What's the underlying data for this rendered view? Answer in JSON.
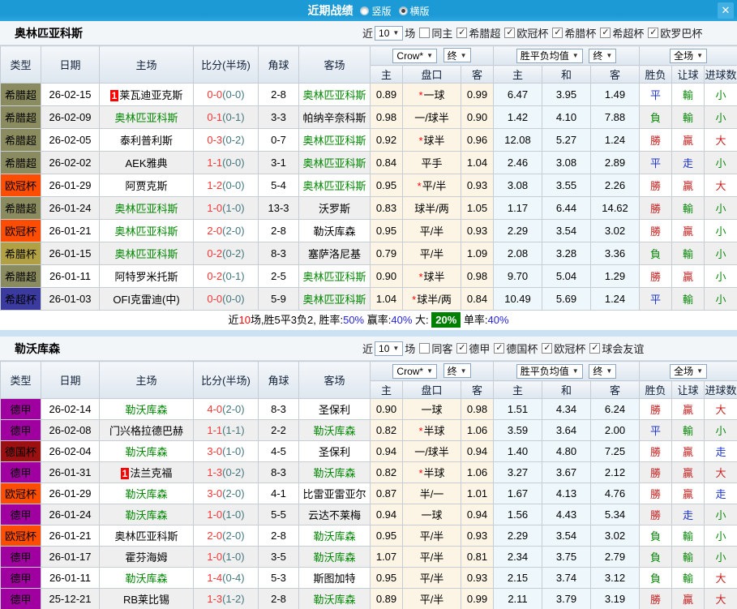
{
  "titlebar": {
    "title": "近期战绩",
    "vertical": "竖版",
    "horizontal": "横版",
    "close": "✕"
  },
  "filter_labels": {
    "near": "近",
    "games": "场"
  },
  "controls": {
    "count": "10",
    "company": "Crow*",
    "final": "终",
    "avg": "胜平负均值",
    "full": "全场"
  },
  "columns": {
    "type": "类型",
    "date": "日期",
    "home": "主场",
    "score": "比分(半场)",
    "corner": "角球",
    "away": "客场",
    "h": "主",
    "handicap": "盘口",
    "a": "客",
    "avg_h": "主",
    "avg_d": "和",
    "avg_a": "客",
    "wdl": "胜负",
    "ah": "让球",
    "goals": "进球数"
  },
  "misc": {
    "star": "*",
    "badge": "1"
  },
  "league_colors": {
    "希腊超": "#8b8b60",
    "欧冠杯": "#fc4d02",
    "希腊杯": "#b2a144",
    "希超杯": "#3a3a9f",
    "德甲": "#a100a1",
    "德国杯": "#9b1111"
  },
  "result_colors": {
    "勝": "#c82121",
    "贏": "#c82121",
    "大": "#c82121",
    "平": "#1d35cc",
    "走": "#1d35cc",
    "負": "#0b8a0b",
    "輸": "#0b8a0b",
    "小": "#0b8a0b"
  },
  "colors": {
    "titlebar": "#1c9ad6",
    "separator": "#cbe2f4",
    "team_highlight": "#008800",
    "score_fulltime": "#ff3333",
    "score_halftime": "#44787f",
    "corner": "#26439c",
    "summary_badge_bg": "#008000",
    "summary_value": "#2323dd"
  },
  "sections": [
    {
      "team": "奥林匹亚科斯",
      "filters": {
        "same": "同主",
        "leagues": [
          "希腊超",
          "欧冠杯",
          "希腊杯",
          "希超杯",
          "欧罗巴杯"
        ]
      },
      "rows": [
        {
          "league": "希腊超",
          "date": "26-02-15",
          "home": "莱瓦迪亚克斯",
          "home_badge": true,
          "home_self": false,
          "score": "0-0",
          "half": "(0-0)",
          "corner": "2-8",
          "away": "奥林匹亚科斯",
          "away_self": true,
          "odds_h": "0.89",
          "star": true,
          "handicap": "一球",
          "odds_a": "0.99",
          "avg_h": "6.47",
          "avg_d": "3.95",
          "avg_a": "1.49",
          "wdl": "平",
          "ah": "輸",
          "goal": "小"
        },
        {
          "league": "希腊超",
          "date": "26-02-09",
          "home": "奥林匹亚科斯",
          "home_self": true,
          "score": "0-1",
          "half": "(0-1)",
          "corner": "3-3",
          "away": "帕纳辛奈科斯",
          "away_self": false,
          "odds_h": "0.98",
          "star": false,
          "handicap": "一/球半",
          "odds_a": "0.90",
          "avg_h": "1.42",
          "avg_d": "4.10",
          "avg_a": "7.88",
          "wdl": "負",
          "ah": "輸",
          "goal": "小"
        },
        {
          "league": "希腊超",
          "date": "26-02-05",
          "home": "泰利普利斯",
          "home_self": false,
          "score": "0-3",
          "half": "(0-2)",
          "corner": "0-7",
          "away": "奥林匹亚科斯",
          "away_self": true,
          "odds_h": "0.92",
          "star": true,
          "handicap": "球半",
          "odds_a": "0.96",
          "avg_h": "12.08",
          "avg_d": "5.27",
          "avg_a": "1.24",
          "wdl": "勝",
          "ah": "贏",
          "goal": "大"
        },
        {
          "league": "希腊超",
          "date": "26-02-02",
          "home": "AEK雅典",
          "home_self": false,
          "score": "1-1",
          "half": "(0-0)",
          "corner": "3-1",
          "away": "奥林匹亚科斯",
          "away_self": true,
          "odds_h": "0.84",
          "star": false,
          "handicap": "平手",
          "odds_a": "1.04",
          "avg_h": "2.46",
          "avg_d": "3.08",
          "avg_a": "2.89",
          "wdl": "平",
          "ah": "走",
          "goal": "小"
        },
        {
          "league": "欧冠杯",
          "date": "26-01-29",
          "home": "阿贾克斯",
          "home_self": false,
          "score": "1-2",
          "half": "(0-0)",
          "corner": "5-4",
          "away": "奥林匹亚科斯",
          "away_self": true,
          "odds_h": "0.95",
          "star": true,
          "handicap": "平/半",
          "odds_a": "0.93",
          "avg_h": "3.08",
          "avg_d": "3.55",
          "avg_a": "2.26",
          "wdl": "勝",
          "ah": "贏",
          "goal": "大"
        },
        {
          "league": "希腊超",
          "date": "26-01-24",
          "home": "奥林匹亚科斯",
          "home_self": true,
          "score": "1-0",
          "half": "(1-0)",
          "corner": "13-3",
          "away": "沃罗斯",
          "away_self": false,
          "odds_h": "0.83",
          "star": false,
          "handicap": "球半/两",
          "odds_a": "1.05",
          "avg_h": "1.17",
          "avg_d": "6.44",
          "avg_a": "14.62",
          "wdl": "勝",
          "ah": "輸",
          "goal": "小"
        },
        {
          "league": "欧冠杯",
          "date": "26-01-21",
          "home": "奥林匹亚科斯",
          "home_self": true,
          "score": "2-0",
          "half": "(2-0)",
          "corner": "2-8",
          "away": "勒沃库森",
          "away_self": false,
          "odds_h": "0.95",
          "star": false,
          "handicap": "平/半",
          "odds_a": "0.93",
          "avg_h": "2.29",
          "avg_d": "3.54",
          "avg_a": "3.02",
          "wdl": "勝",
          "ah": "贏",
          "goal": "小"
        },
        {
          "league": "希腊杯",
          "date": "26-01-15",
          "home": "奥林匹亚科斯",
          "home_self": true,
          "score": "0-2",
          "half": "(0-2)",
          "corner": "8-3",
          "away": "塞萨洛尼基",
          "away_self": false,
          "odds_h": "0.79",
          "star": false,
          "handicap": "平/半",
          "odds_a": "1.09",
          "avg_h": "2.08",
          "avg_d": "3.28",
          "avg_a": "3.36",
          "wdl": "負",
          "ah": "輸",
          "goal": "小"
        },
        {
          "league": "希腊超",
          "date": "26-01-11",
          "home": "阿特罗米托斯",
          "home_self": false,
          "score": "0-2",
          "half": "(0-1)",
          "corner": "2-5",
          "away": "奥林匹亚科斯",
          "away_self": true,
          "odds_h": "0.90",
          "star": true,
          "handicap": "球半",
          "odds_a": "0.98",
          "avg_h": "9.70",
          "avg_d": "5.04",
          "avg_a": "1.29",
          "wdl": "勝",
          "ah": "贏",
          "goal": "小"
        },
        {
          "league": "希超杯",
          "date": "26-01-03",
          "home": "OFI克雷迪(中)",
          "home_self": false,
          "score": "0-0",
          "half": "(0-0)",
          "corner": "5-9",
          "away": "奥林匹亚科斯",
          "away_self": true,
          "odds_h": "1.04",
          "star": true,
          "handicap": "球半/两",
          "odds_a": "0.84",
          "avg_h": "10.49",
          "avg_d": "5.69",
          "avg_a": "1.24",
          "wdl": "平",
          "ah": "輸",
          "goal": "小"
        }
      ],
      "summary": [
        {
          "t": "近"
        },
        {
          "t": "10",
          "c": "red"
        },
        {
          "t": "场,胜5平3负2, "
        },
        {
          "t": "胜率:"
        },
        {
          "t": "50%",
          "c": "blue"
        },
        {
          "t": " 赢率:"
        },
        {
          "t": "40%",
          "c": "blue"
        },
        {
          "t": " 大: "
        },
        {
          "t": "20%",
          "c": "badge"
        },
        {
          "t": " 单率:"
        },
        {
          "t": "40%",
          "c": "blue"
        }
      ]
    },
    {
      "team": "勒沃库森",
      "filters": {
        "same": "同客",
        "leagues": [
          "德甲",
          "德国杯",
          "欧冠杯",
          "球会友谊"
        ]
      },
      "rows": [
        {
          "league": "德甲",
          "date": "26-02-14",
          "home": "勒沃库森",
          "home_self": true,
          "score": "4-0",
          "half": "(2-0)",
          "corner": "8-3",
          "away": "圣保利",
          "away_self": false,
          "odds_h": "0.90",
          "star": false,
          "handicap": "一球",
          "odds_a": "0.98",
          "avg_h": "1.51",
          "avg_d": "4.34",
          "avg_a": "6.24",
          "wdl": "勝",
          "ah": "贏",
          "goal": "大"
        },
        {
          "league": "德甲",
          "date": "26-02-08",
          "home": "门兴格拉德巴赫",
          "home_self": false,
          "score": "1-1",
          "half": "(1-1)",
          "corner": "2-2",
          "away": "勒沃库森",
          "away_self": true,
          "odds_h": "0.82",
          "star": true,
          "handicap": "半球",
          "odds_a": "1.06",
          "avg_h": "3.59",
          "avg_d": "3.64",
          "avg_a": "2.00",
          "wdl": "平",
          "ah": "輸",
          "goal": "小"
        },
        {
          "league": "德国杯",
          "date": "26-02-04",
          "home": "勒沃库森",
          "home_self": true,
          "score": "3-0",
          "half": "(1-0)",
          "corner": "4-5",
          "away": "圣保利",
          "away_self": false,
          "odds_h": "0.94",
          "star": false,
          "handicap": "一/球半",
          "odds_a": "0.94",
          "avg_h": "1.40",
          "avg_d": "4.80",
          "avg_a": "7.25",
          "wdl": "勝",
          "ah": "贏",
          "goal": "走"
        },
        {
          "league": "德甲",
          "date": "26-01-31",
          "home": "法兰克福",
          "home_badge": true,
          "home_self": false,
          "score": "1-3",
          "half": "(0-2)",
          "corner": "8-3",
          "away": "勒沃库森",
          "away_self": true,
          "odds_h": "0.82",
          "star": true,
          "handicap": "半球",
          "odds_a": "1.06",
          "avg_h": "3.27",
          "avg_d": "3.67",
          "avg_a": "2.12",
          "wdl": "勝",
          "ah": "贏",
          "goal": "大"
        },
        {
          "league": "欧冠杯",
          "date": "26-01-29",
          "home": "勒沃库森",
          "home_self": true,
          "score": "3-0",
          "half": "(2-0)",
          "corner": "4-1",
          "away": "比雷亚雷亚尔",
          "away_self": false,
          "odds_h": "0.87",
          "star": false,
          "handicap": "半/一",
          "odds_a": "1.01",
          "avg_h": "1.67",
          "avg_d": "4.13",
          "avg_a": "4.76",
          "wdl": "勝",
          "ah": "贏",
          "goal": "走"
        },
        {
          "league": "德甲",
          "date": "26-01-24",
          "home": "勒沃库森",
          "home_self": true,
          "score": "1-0",
          "half": "(1-0)",
          "corner": "5-5",
          "away": "云达不莱梅",
          "away_self": false,
          "odds_h": "0.94",
          "star": false,
          "handicap": "一球",
          "odds_a": "0.94",
          "avg_h": "1.56",
          "avg_d": "4.43",
          "avg_a": "5.34",
          "wdl": "勝",
          "ah": "走",
          "goal": "小"
        },
        {
          "league": "欧冠杯",
          "date": "26-01-21",
          "home": "奥林匹亚科斯",
          "home_self": false,
          "score": "2-0",
          "half": "(2-0)",
          "corner": "2-8",
          "away": "勒沃库森",
          "away_self": true,
          "odds_h": "0.95",
          "star": false,
          "handicap": "平/半",
          "odds_a": "0.93",
          "avg_h": "2.29",
          "avg_d": "3.54",
          "avg_a": "3.02",
          "wdl": "負",
          "ah": "輸",
          "goal": "小"
        },
        {
          "league": "德甲",
          "date": "26-01-17",
          "home": "霍芬海姆",
          "home_self": false,
          "score": "1-0",
          "half": "(1-0)",
          "corner": "3-5",
          "away": "勒沃库森",
          "away_self": true,
          "odds_h": "1.07",
          "star": false,
          "handicap": "平/半",
          "odds_a": "0.81",
          "avg_h": "2.34",
          "avg_d": "3.75",
          "avg_a": "2.79",
          "wdl": "負",
          "ah": "輸",
          "goal": "小"
        },
        {
          "league": "德甲",
          "date": "26-01-11",
          "home": "勒沃库森",
          "home_self": true,
          "score": "1-4",
          "half": "(0-4)",
          "corner": "5-3",
          "away": "斯图加特",
          "away_self": false,
          "odds_h": "0.95",
          "star": false,
          "handicap": "平/半",
          "odds_a": "0.93",
          "avg_h": "2.15",
          "avg_d": "3.74",
          "avg_a": "3.12",
          "wdl": "負",
          "ah": "輸",
          "goal": "大"
        },
        {
          "league": "德甲",
          "date": "25-12-21",
          "home": "RB莱比锡",
          "home_self": false,
          "score": "1-3",
          "half": "(1-2)",
          "corner": "2-8",
          "away": "勒沃库森",
          "away_self": true,
          "odds_h": "0.89",
          "star": false,
          "handicap": "平/半",
          "odds_a": "0.99",
          "avg_h": "2.11",
          "avg_d": "3.79",
          "avg_a": "3.19",
          "wdl": "勝",
          "ah": "贏",
          "goal": "大"
        }
      ],
      "summary": []
    }
  ]
}
